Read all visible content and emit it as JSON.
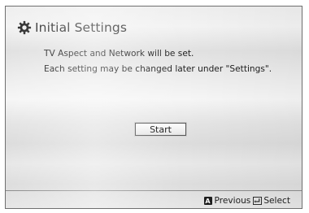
{
  "dialog": {
    "title": "Initial Settings",
    "icon": "gear-icon",
    "message_line1": "TV Aspect and Network will be set.",
    "message_line2": "Each setting may be changed later under \"Settings\".",
    "start_label": "Start"
  },
  "footer": {
    "previous_key": "A",
    "previous_label": "Previous",
    "select_icon": "enter-icon",
    "select_label": "Select"
  }
}
